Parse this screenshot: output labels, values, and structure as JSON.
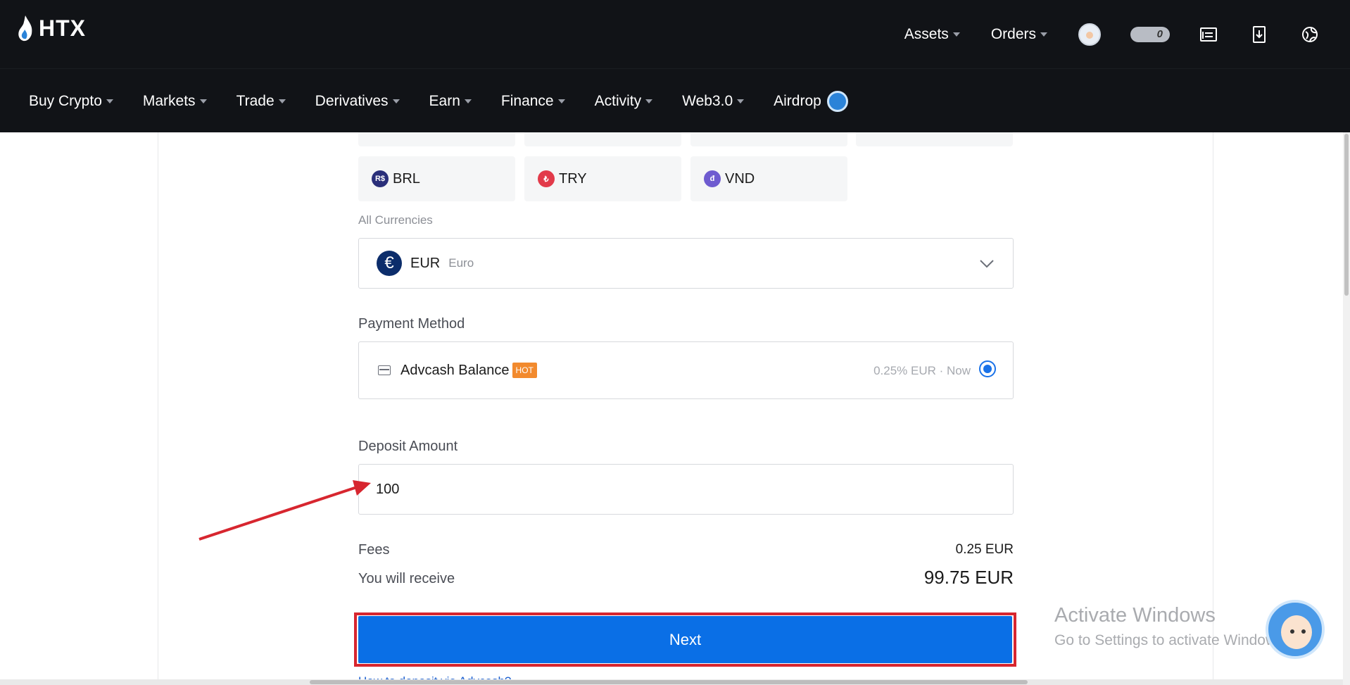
{
  "header": {
    "logo_text": "HTX",
    "assets_label": "Assets",
    "orders_label": "Orders",
    "notification_count": "0"
  },
  "nav": {
    "items": [
      {
        "label": "Buy Crypto"
      },
      {
        "label": "Markets"
      },
      {
        "label": "Trade"
      },
      {
        "label": "Derivatives"
      },
      {
        "label": "Earn"
      },
      {
        "label": "Finance"
      },
      {
        "label": "Activity"
      },
      {
        "label": "Web3.0"
      },
      {
        "label": "Airdrop"
      }
    ]
  },
  "currencies": {
    "tiles": [
      {
        "code": "BRL",
        "icon": "R$",
        "color": "#2a2f7a"
      },
      {
        "code": "TRY",
        "icon": "₺",
        "color": "#e23a4a"
      },
      {
        "code": "VND",
        "icon": "đ",
        "color": "#6e5bd0"
      }
    ],
    "all_label": "All Currencies",
    "selected": {
      "code": "EUR",
      "name": "Euro",
      "icon": "€"
    }
  },
  "payment": {
    "label": "Payment Method",
    "method_name": "Advcash Balance",
    "badge": "HOT",
    "meta": "0.25% EUR · Now",
    "selected": true
  },
  "deposit": {
    "label": "Deposit Amount",
    "value": "100"
  },
  "summary": {
    "fees_label": "Fees",
    "fees_value": "0.25 EUR",
    "receive_label": "You will receive",
    "receive_value": "99.75 EUR"
  },
  "actions": {
    "next_label": "Next",
    "help_link": "How to deposit via Advcash?"
  },
  "watermark": {
    "title": "Activate Windows",
    "subtitle": "Go to Settings to activate Windows."
  },
  "colors": {
    "accent": "#0a6fe6",
    "highlight": "#d7262f",
    "hot": "#f28a2e",
    "header_bg": "#111317"
  }
}
